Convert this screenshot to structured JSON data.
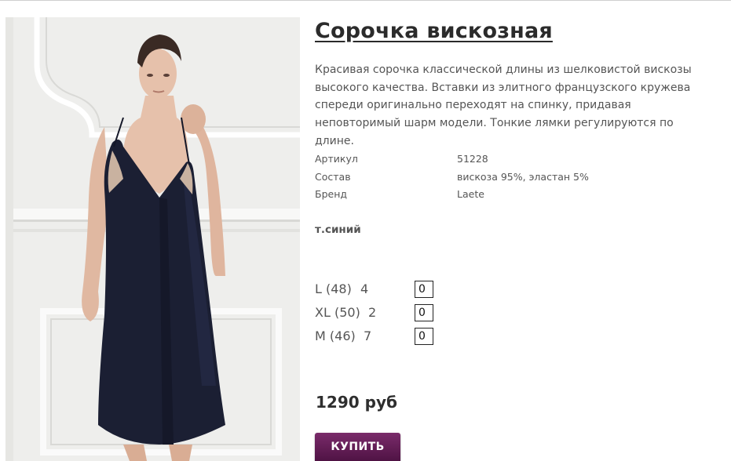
{
  "product": {
    "title": "Сорочка вискозная",
    "description": "Красивая сорочка классической длины из шелковистой вискозы высокого качества. Вставки из элитного французского кружева спереди оригинально переходят на спинку, придавая неповторимый шарм модели. Тонкие лямки регулируются по длине.",
    "attributes": [
      {
        "label": "Артикул",
        "value": "51228"
      },
      {
        "label": "Состав",
        "value": "вискоза 95%, эластан 5%"
      },
      {
        "label": "Бренд",
        "value": "Laete"
      }
    ],
    "color_name": "т.синий",
    "sizes": [
      {
        "label": "L (48)",
        "stock": "4",
        "qty": "0"
      },
      {
        "label": "XL (50)",
        "stock": "2",
        "qty": "0"
      },
      {
        "label": "M (46)",
        "stock": "7",
        "qty": "0"
      }
    ],
    "price": "1290 руб",
    "buy_label": "КУПИТЬ"
  },
  "colors": {
    "button": "#5e1a52",
    "dress": "#1b1f33",
    "lace": "#c9b2a0",
    "skin": "#e4bfa9",
    "hair": "#3a2a24",
    "wall": "#eeeeec"
  },
  "icons": {
    "photo": "model-in-navy-slip-dress"
  }
}
